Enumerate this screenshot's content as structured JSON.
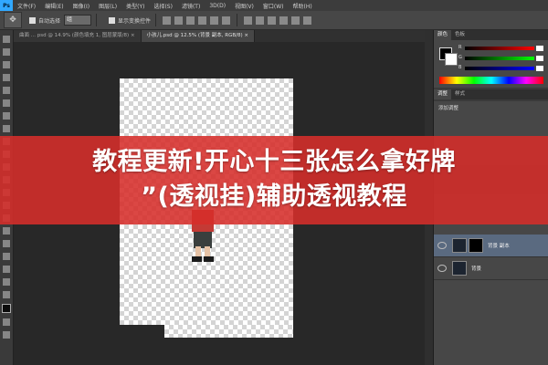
{
  "app": {
    "logo": "Ps"
  },
  "menu": [
    "文件(F)",
    "编辑(E)",
    "图像(I)",
    "图层(L)",
    "类型(Y)",
    "选择(S)",
    "滤镜(T)",
    "3D(D)",
    "视图(V)",
    "窗口(W)",
    "帮助(H)"
  ],
  "options": {
    "tool_icon": "move-tool-icon",
    "auto_select": "自动选择",
    "auto_select_value": "组",
    "transform_controls": "显示变换控件"
  },
  "tabs": [
    {
      "label": "曲面 ... psd @ 14.9% (颜色填充 1, 图层蒙版/8) ×",
      "active": false
    },
    {
      "label": "小孩儿.psd @ 12.5% (背景 副本, RGB/8) ×",
      "active": true
    }
  ],
  "panels": {
    "color_tabs": [
      "颜色",
      "色板"
    ],
    "channels": [
      "R",
      "G",
      "B"
    ],
    "adjust_tabs": [
      "调整",
      "样式"
    ],
    "adjust_title": "添加调整",
    "layers": [
      {
        "name": "背景 副本",
        "selected": true
      },
      {
        "name": "背景",
        "selected": false
      }
    ]
  },
  "banner": {
    "line1": "教程更新!开心十三张怎么拿好牌",
    "line2": "”(透视挂)辅助透视教程",
    "color": "#d62d2a"
  }
}
